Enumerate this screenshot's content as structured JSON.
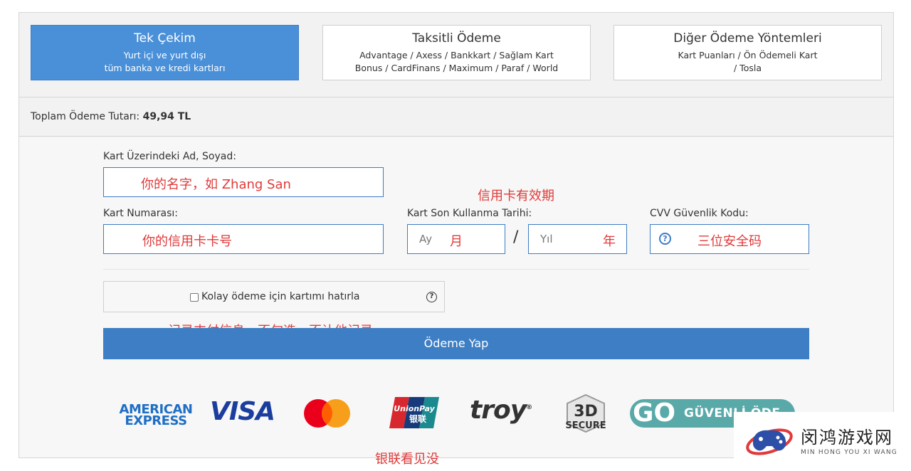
{
  "tabs": [
    {
      "title": "Tek Çekim",
      "sub1": "Yurt içi ve yurt dışı",
      "sub2": "tüm banka ve kredi kartları",
      "active": true
    },
    {
      "title": "Taksitli Ödeme",
      "sub1": "Advantage / Axess / Bankkart / Sağlam Kart",
      "sub2": "Bonus / CardFinans / Maximum / Paraf / World",
      "active": false
    },
    {
      "title": "Diğer Ödeme Yöntemleri",
      "sub1": "Kart Puanları / Ön Ödemeli Kart",
      "sub2": "/ Tosla",
      "active": false
    }
  ],
  "total": {
    "label": "Toplam Ödeme Tutarı:",
    "amount": "49,94 TL"
  },
  "form": {
    "name_label": "Kart Üzerindeki Ad, Soyad:",
    "number_label": "Kart Numarası:",
    "expiry_label": "Kart Son Kullanma Tarihi:",
    "cvv_label": "CVV Güvenlik Kodu:",
    "month_placeholder": "Ay",
    "year_placeholder": "Yıl",
    "separator": "/",
    "remember_label": "Kolay ödeme için kartımı hatırla",
    "pay_button": "Ödeme Yap"
  },
  "annotations": {
    "name": "你的名字，如 Zhang San",
    "expiry": "信用卡有效期",
    "number": "你的信用卡卡号",
    "month": "月",
    "year": "年",
    "cvv": "三位安全码",
    "remember": "记录支付信息，不勾选，不让他记录",
    "unionpay": "银联看见没"
  },
  "logos": {
    "amex_line1": "AMERICAN",
    "amex_line2": "EXPRESS",
    "visa": "VISA",
    "unionpay_en": "UnionPay",
    "unionpay_cn": "银联",
    "troy": "troy",
    "secure_top": "3D",
    "secure_bottom": "SECURE",
    "go": "GO",
    "go_text": "GÜVENLİ ÖDE"
  },
  "watermark": {
    "title": "闵鸿游戏网",
    "sub": "MIN HONG YOU XI WANG"
  },
  "colors": {
    "accent": "#3d7ec4",
    "annotation": "#e03a3a",
    "mastercard_red": "#eb001b",
    "mastercard_orange": "#f79e1b"
  }
}
